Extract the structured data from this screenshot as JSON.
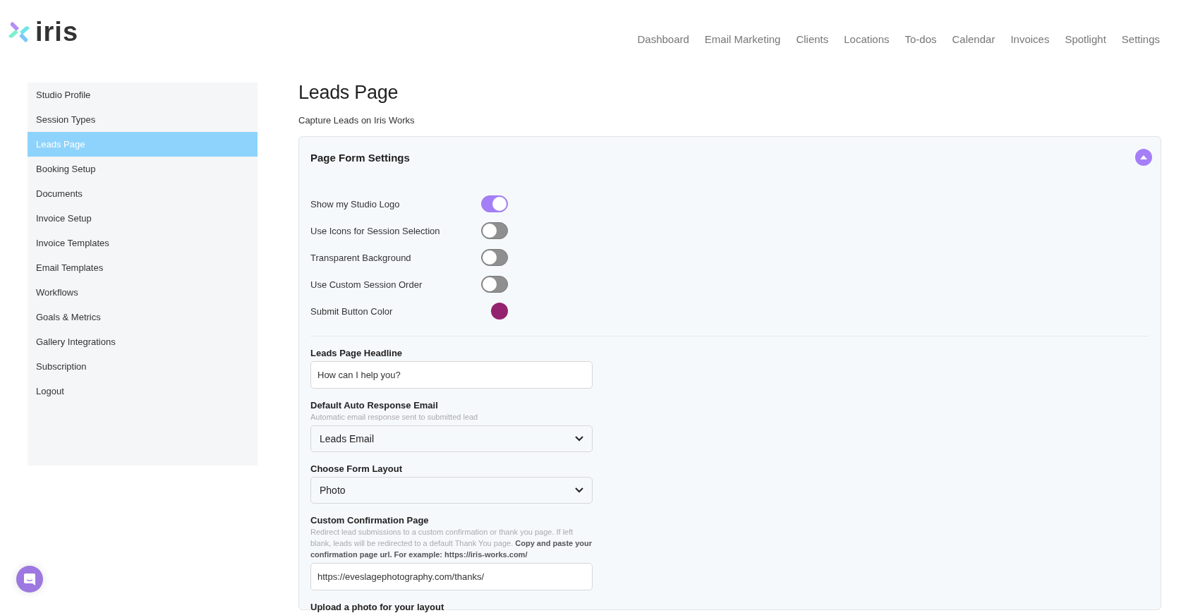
{
  "header": {
    "logo_text": "iris",
    "nav": [
      {
        "label": "Dashboard"
      },
      {
        "label": "Email Marketing"
      },
      {
        "label": "Clients"
      },
      {
        "label": "Locations"
      },
      {
        "label": "To-dos"
      },
      {
        "label": "Calendar"
      },
      {
        "label": "Invoices"
      },
      {
        "label": "Spotlight"
      },
      {
        "label": "Settings"
      }
    ]
  },
  "sidebar": {
    "items": [
      {
        "label": "Studio Profile",
        "selected": false
      },
      {
        "label": "Session Types",
        "selected": false
      },
      {
        "label": "Leads Page",
        "selected": true
      },
      {
        "label": "Booking Setup",
        "selected": false
      },
      {
        "label": "Documents",
        "selected": false
      },
      {
        "label": "Invoice Setup",
        "selected": false
      },
      {
        "label": "Invoice Templates",
        "selected": false
      },
      {
        "label": "Email Templates",
        "selected": false
      },
      {
        "label": "Workflows",
        "selected": false
      },
      {
        "label": "Goals & Metrics",
        "selected": false
      },
      {
        "label": "Gallery Integrations",
        "selected": false
      },
      {
        "label": "Subscription",
        "selected": false
      },
      {
        "label": "Logout",
        "selected": false
      }
    ]
  },
  "page": {
    "title": "Leads Page",
    "subtitle": "Capture Leads on Iris Works"
  },
  "card": {
    "title": "Page Form Settings",
    "expanded": true,
    "settings": [
      {
        "kind": "toggle",
        "label": "Show my Studio Logo",
        "on": true
      },
      {
        "kind": "toggle",
        "label": "Use Icons for Session Selection",
        "on": false
      },
      {
        "kind": "toggle",
        "label": "Transparent Background",
        "on": false
      },
      {
        "kind": "toggle",
        "label": "Use Custom Session Order",
        "on": false
      },
      {
        "kind": "color",
        "label": "Submit Button Color",
        "color": "#94236f"
      }
    ],
    "fields": [
      {
        "kind": "text",
        "label": "Leads Page Headline",
        "value": "How can I help you?"
      },
      {
        "kind": "select",
        "label": "Default Auto Response Email",
        "hint": "Automatic email response sent to submitted lead",
        "value": "Leads Email"
      },
      {
        "kind": "select",
        "label": "Choose Form Layout",
        "value": "Photo"
      },
      {
        "kind": "text",
        "label": "Custom Confirmation Page",
        "hint": "Redirect lead submissions to a custom confirmation or thank you page. If left blank, leads will be redirected to a default Thank You page. **Copy and paste your confirmation page url. For example: https://iris-works.com/**",
        "value": "https://eveslagephotography.com/thanks/"
      },
      {
        "kind": "upload",
        "label": "Upload a photo for your layout"
      }
    ]
  }
}
